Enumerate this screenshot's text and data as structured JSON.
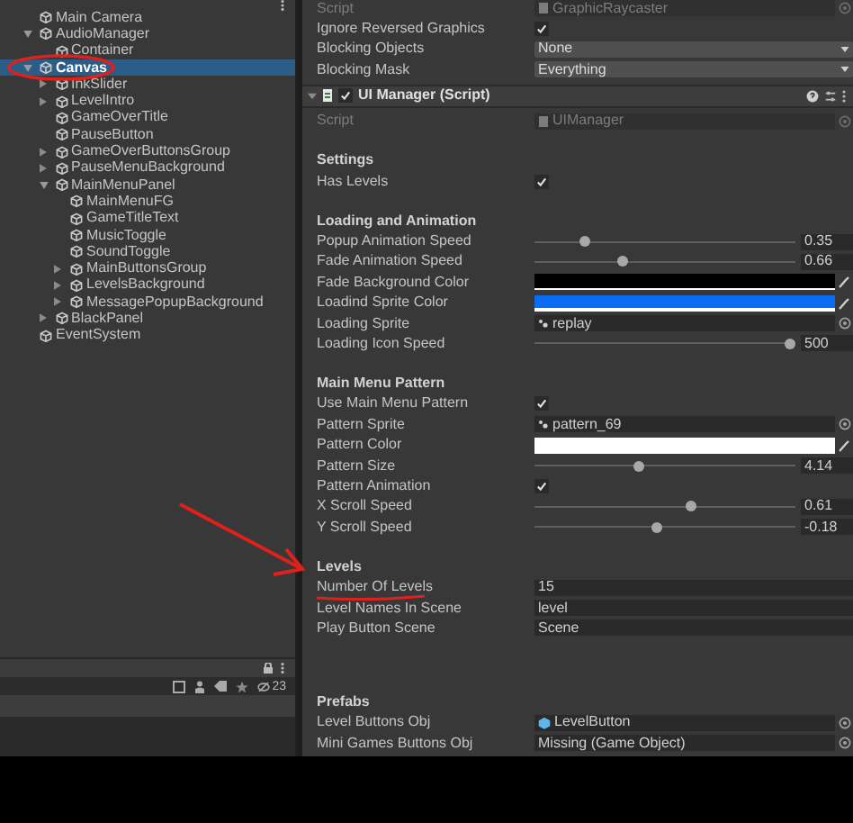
{
  "hierarchy": {
    "items": [
      {
        "label": "Main Camera",
        "selected": false
      },
      {
        "label": "AudioManager",
        "expanded": true,
        "selected": false,
        "children": [
          {
            "label": "Container",
            "selected": false
          }
        ]
      },
      {
        "label": "Canvas",
        "expanded": true,
        "selected": true,
        "children": [
          {
            "label": "InkSlider",
            "expanded": false,
            "selected": false
          },
          {
            "label": "LevelIntro",
            "expanded": false,
            "selected": false
          },
          {
            "label": "GameOverTitle",
            "selected": false
          },
          {
            "label": "PauseButton",
            "selected": false
          },
          {
            "label": "GameOverButtonsGroup",
            "expanded": false,
            "selected": false
          },
          {
            "label": "PauseMenuBackground",
            "expanded": false,
            "selected": false
          },
          {
            "label": "MainMenuPanel",
            "expanded": true,
            "selected": false,
            "children": [
              {
                "label": "MainMenuFG",
                "selected": false
              },
              {
                "label": "GameTitleText",
                "selected": false
              },
              {
                "label": "MusicToggle",
                "selected": false
              },
              {
                "label": "SoundToggle",
                "selected": false
              },
              {
                "label": "MainButtonsGroup",
                "expanded": false,
                "selected": false
              },
              {
                "label": "LevelsBackground",
                "expanded": false,
                "selected": false
              },
              {
                "label": "MessagePopupBackground",
                "expanded": false,
                "selected": false
              }
            ]
          },
          {
            "label": "BlackPanel",
            "expanded": false,
            "selected": false
          }
        ]
      },
      {
        "label": "EventSystem",
        "selected": false
      }
    ],
    "hidden_count": "23"
  },
  "inspector": {
    "top_rows": [
      {
        "kind": "script",
        "label": "Script",
        "value": "GraphicRaycaster"
      },
      {
        "kind": "checkbox",
        "label": "Ignore Reversed Graphics",
        "checked": true
      },
      {
        "kind": "dropdown",
        "label": "Blocking Objects",
        "value": "None"
      },
      {
        "kind": "dropdown",
        "label": "Blocking Mask",
        "value": "Everything"
      }
    ],
    "component": {
      "title": "UI Manager (Script)",
      "enabled": true,
      "expanded": true
    },
    "rows": [
      {
        "kind": "script",
        "label": "Script",
        "value": "UIManager"
      },
      {
        "kind": "header",
        "label": "Settings"
      },
      {
        "kind": "checkbox",
        "label": "Has Levels",
        "checked": true
      },
      {
        "kind": "header",
        "label": "Loading and Animation"
      },
      {
        "kind": "slider",
        "label": "Popup Animation Speed",
        "level": 0.19,
        "value": "0.35"
      },
      {
        "kind": "slider",
        "label": "Fade Animation Speed",
        "level": 0.34,
        "value": "0.66"
      },
      {
        "kind": "color",
        "label": "Fade Background Color",
        "color": "#000000"
      },
      {
        "kind": "color",
        "label": "Loadind Sprite Color",
        "color": "#0a6cf0"
      },
      {
        "kind": "sprite",
        "label": "Loading Sprite",
        "value": "replay"
      },
      {
        "kind": "slider",
        "label": "Loading Icon Speed",
        "level": 0.98,
        "value": "500"
      },
      {
        "kind": "header",
        "label": "Main Menu Pattern"
      },
      {
        "kind": "checkbox",
        "label": "Use Main Menu Pattern",
        "checked": true
      },
      {
        "kind": "sprite",
        "label": "Pattern Sprite",
        "value": "pattern_69"
      },
      {
        "kind": "color",
        "label": "Pattern Color",
        "color": "#ffffff"
      },
      {
        "kind": "slider",
        "label": "Pattern Size",
        "level": 0.4,
        "value": "4.14"
      },
      {
        "kind": "checkbox",
        "label": "Pattern Animation",
        "checked": true
      },
      {
        "kind": "slider",
        "label": "X Scroll Speed",
        "level": 0.6,
        "value": "0.61"
      },
      {
        "kind": "slider",
        "label": "Y Scroll Speed",
        "level": 0.47,
        "value": "-0.18"
      },
      {
        "kind": "header",
        "label": "Levels"
      },
      {
        "kind": "text",
        "label": "Number Of Levels",
        "value": "15"
      },
      {
        "kind": "text",
        "label": "Level Names In Scene",
        "value": "level"
      },
      {
        "kind": "text",
        "label": "Play Button Scene",
        "value": "Scene"
      },
      {
        "kind": "header",
        "label": "Prefabs",
        "wide_gap": true
      },
      {
        "kind": "prefab",
        "label": "Level Buttons Obj",
        "value": "LevelButton"
      },
      {
        "kind": "object",
        "label": "Mini Games Buttons Obj",
        "value": "Missing (Game Object)"
      }
    ]
  }
}
